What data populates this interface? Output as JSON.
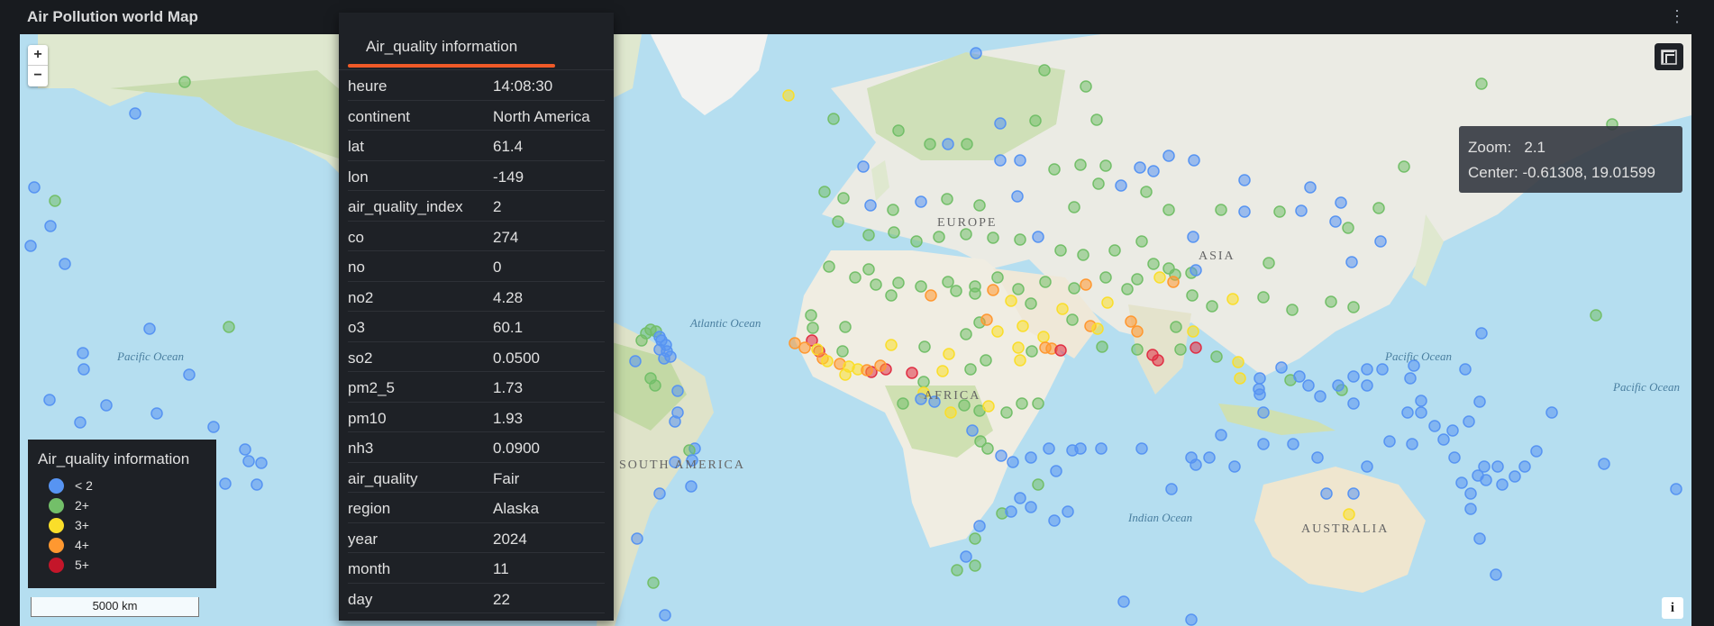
{
  "panel": {
    "title": "Air Pollution world Map",
    "menu_icon": "vertical-dots-icon"
  },
  "map": {
    "zoom_in_label": "+",
    "zoom_out_label": "−",
    "zoom_label": "Zoom:",
    "zoom_value": "2.1",
    "center_label": "Center:",
    "center_value": "-0.61308, 19.01599",
    "scale_label": "5000 km",
    "info_label": "i",
    "place_labels": [
      "EUROPE",
      "ASIA",
      "AFRICA",
      "SOUTH AMERICA",
      "AUSTRALIA",
      "Atlantic Ocean",
      "Pacific Ocean",
      "Pacific Ocean",
      "Pacific Ocean",
      "Indian Ocean"
    ]
  },
  "legend": {
    "title": "Air_quality information",
    "items": [
      {
        "label": "< 2",
        "color": "#5794f2"
      },
      {
        "label": "2+",
        "color": "#73bf69"
      },
      {
        "label": "3+",
        "color": "#fade2a"
      },
      {
        "label": "4+",
        "color": "#ff9830"
      },
      {
        "label": "5+",
        "color": "#c4162a"
      }
    ]
  },
  "tooltip": {
    "title": "Air_quality information",
    "rows": [
      {
        "key": "heure",
        "value": "14:08:30"
      },
      {
        "key": "continent",
        "value": "North America"
      },
      {
        "key": "lat",
        "value": "61.4"
      },
      {
        "key": "lon",
        "value": "-149"
      },
      {
        "key": "air_quality_index",
        "value": "2"
      },
      {
        "key": "co",
        "value": "274"
      },
      {
        "key": "no",
        "value": "0"
      },
      {
        "key": "no2",
        "value": "4.28"
      },
      {
        "key": "o3",
        "value": "60.1"
      },
      {
        "key": "so2",
        "value": "0.0500"
      },
      {
        "key": "pm2_5",
        "value": "1.73"
      },
      {
        "key": "pm10",
        "value": "1.93"
      },
      {
        "key": "nh3",
        "value": "0.0900"
      },
      {
        "key": "air_quality",
        "value": "Fair"
      },
      {
        "key": "region",
        "value": "Alaska"
      },
      {
        "key": "year",
        "value": "2024"
      },
      {
        "key": "month",
        "value": "11"
      },
      {
        "key": "day",
        "value": "22"
      }
    ]
  }
}
